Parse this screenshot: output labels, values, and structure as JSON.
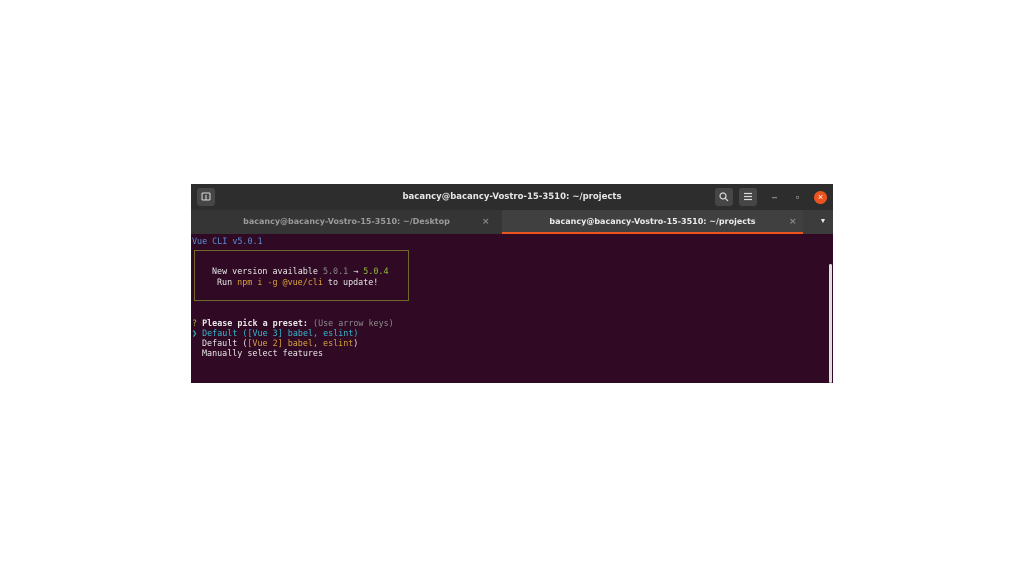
{
  "window": {
    "title": "bacancy@bacancy-Vostro-15-3510: ~/projects",
    "controls": {
      "minimize": "–",
      "maximize": "▫",
      "close": "×"
    }
  },
  "tabs": [
    {
      "label": "bacancy@bacancy-Vostro-15-3510: ~/Desktop",
      "close": "×",
      "active": false
    },
    {
      "label": "bacancy@bacancy-Vostro-15-3510: ~/projects",
      "close": "×",
      "active": true
    }
  ],
  "terminal": {
    "version_line": "Vue CLI v5.0.1",
    "update_notice": {
      "line1_prefix": "New version available ",
      "old_version": "5.0.1",
      "arrow": " → ",
      "new_version": "5.0.4",
      "line2_run": "Run ",
      "command": "npm i -g @vue/cli",
      "line2_suffix": " to update!"
    },
    "prompt": {
      "marker": "?",
      "question": "Please pick a preset:",
      "hint": " (Use arrow keys)"
    },
    "options": [
      {
        "pointer": "❯",
        "name": "Default",
        "detail": " ([Vue 3] babel, eslint)",
        "selected": true
      },
      {
        "pointer": " ",
        "name": "Default",
        "detail_open": " (",
        "detail_mid": "[Vue 2] babel, eslint",
        "detail_close": ")",
        "selected": false
      },
      {
        "pointer": " ",
        "name": "Manually select features",
        "selected": false
      }
    ]
  },
  "colors": {
    "terminal_bg": "#300a24",
    "accent": "#e95420",
    "version": "#5b8fd6",
    "new_version": "#8fbf3e",
    "command": "#d7a23a",
    "selected": "#35b7cc"
  }
}
